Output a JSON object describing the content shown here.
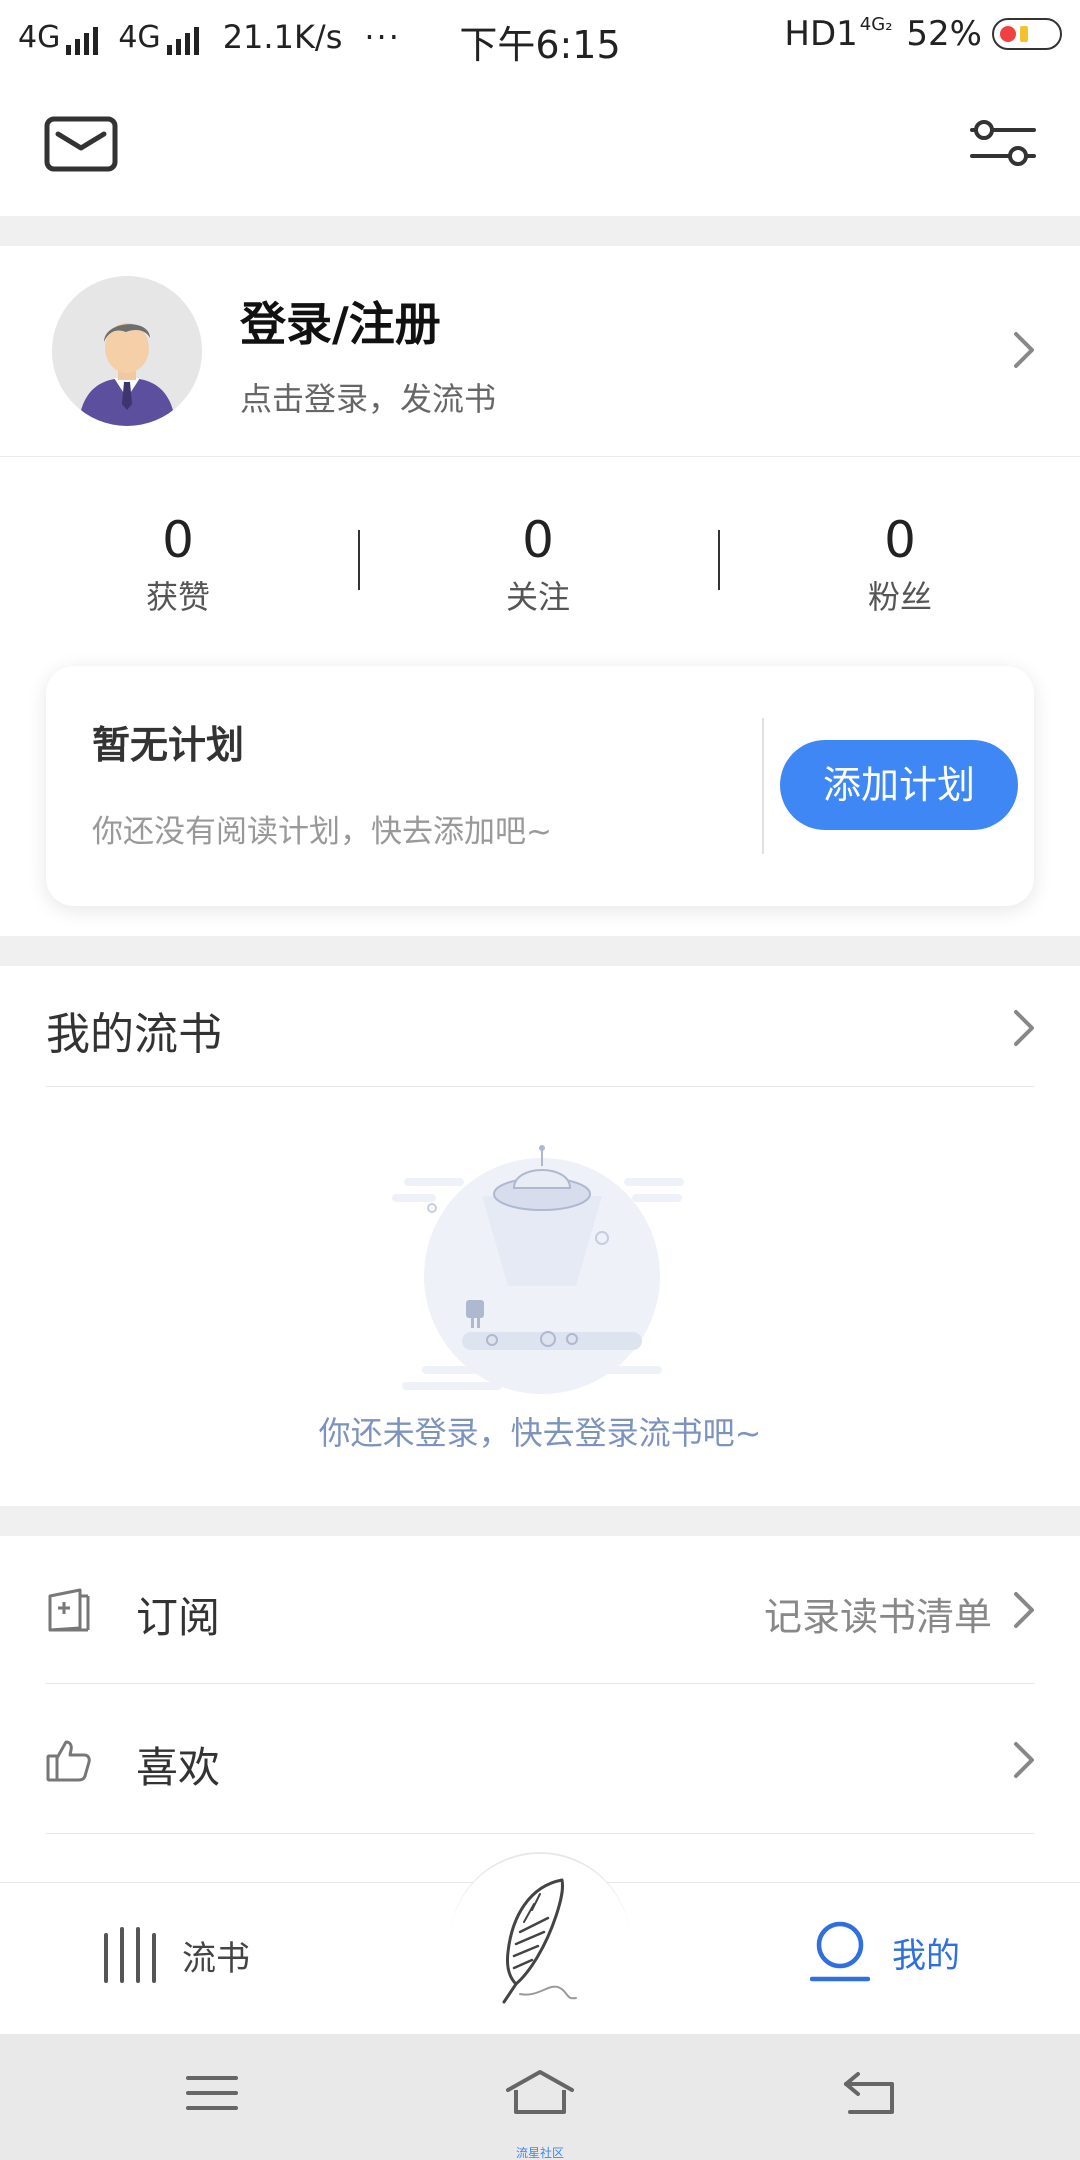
{
  "status_bar": {
    "net1": "4G",
    "net2": "4G",
    "speed": "21.1K/s",
    "dots": "···",
    "time": "下午6:15",
    "hd": "HD1",
    "net3": "4G₂",
    "battery": "52%"
  },
  "profile": {
    "title": "登录/注册",
    "subtitle": "点击登录，发流书"
  },
  "stats": [
    {
      "value": "0",
      "label": "获赞"
    },
    {
      "value": "0",
      "label": "关注"
    },
    {
      "value": "0",
      "label": "粉丝"
    }
  ],
  "plan": {
    "title": "暂无计划",
    "subtitle": "你还没有阅读计划，快去添加吧~",
    "button": "添加计划"
  },
  "my_section": {
    "title": "我的流书",
    "empty_text": "你还未登录，快去登录流书吧~"
  },
  "menu": [
    {
      "label": "订阅",
      "extra": "记录读书清单",
      "icon": "subscribe-icon"
    },
    {
      "label": "喜欢",
      "extra": "",
      "icon": "thumbs-up-icon"
    }
  ],
  "tabs": {
    "left": "流书",
    "right": "我的"
  },
  "system_nav": {
    "caption": "流星社区"
  },
  "colors": {
    "accent": "#3f87f5",
    "active_tab": "#2f6fe0",
    "empty_text": "#7d93bf"
  }
}
